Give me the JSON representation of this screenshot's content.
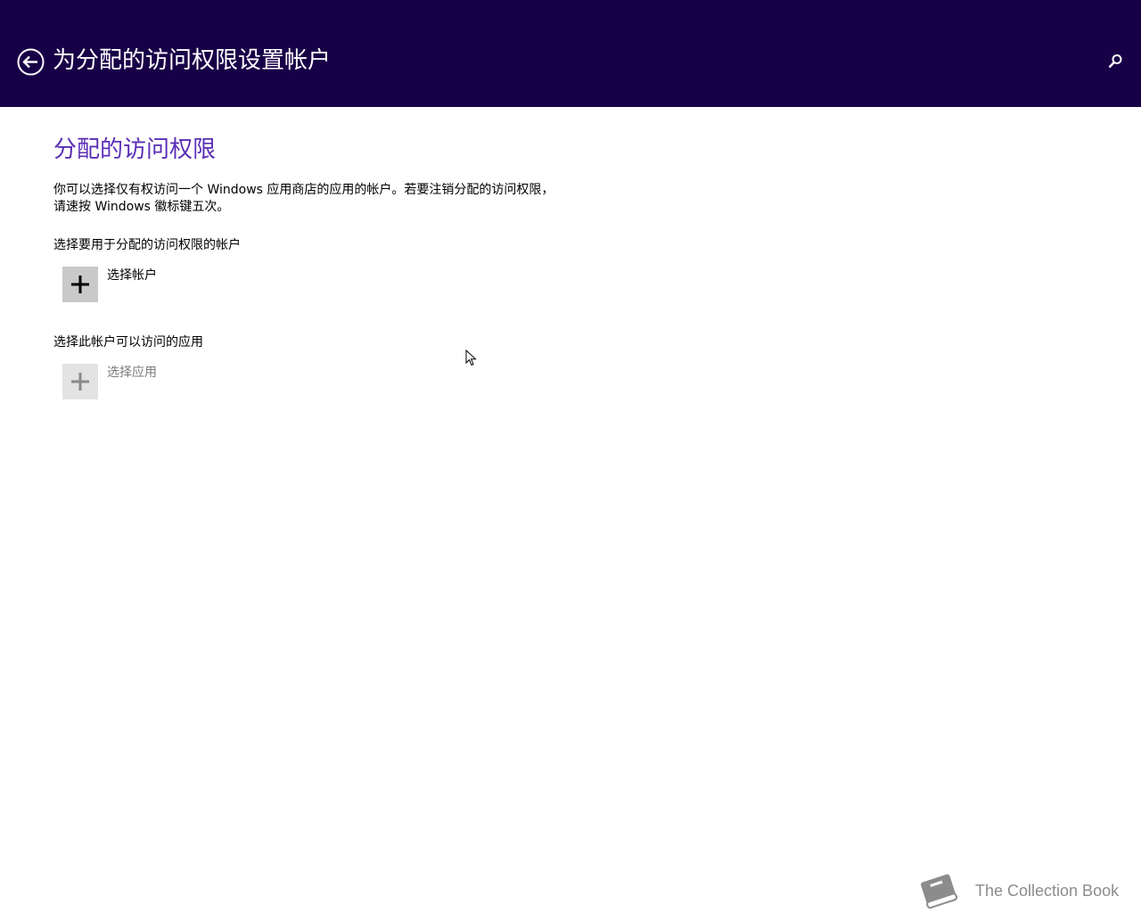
{
  "header": {
    "title": "为分配的访问权限设置帐户",
    "back_icon": "back-arrow-circle-icon",
    "search_icon": "search-icon",
    "background_color": "#180047"
  },
  "main": {
    "section_title": "分配的访问权限",
    "section_title_color": "#5a2eb6",
    "description_lines": [
      "你可以选择仅有权访问一个 Windows 应用商店的应用的帐户。若要注销分配的访问权限，",
      "请速按 Windows 徽标键五次。"
    ],
    "account": {
      "label": "选择要用于分配的访问权限的帐户",
      "button_label": "选择帐户",
      "icon": "plus-icon"
    },
    "app": {
      "label": "选择此帐户可以访问的应用",
      "button_label": "选择应用",
      "icon": "plus-icon"
    }
  },
  "watermark": {
    "text": "The Collection Book",
    "icon": "book-icon"
  }
}
